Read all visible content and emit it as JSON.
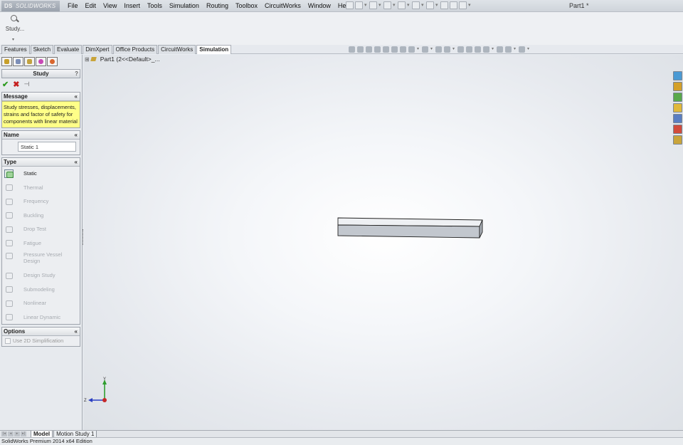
{
  "app": {
    "logo_prefix": "DS",
    "logo_text": "SOLIDWORKS",
    "document_title": "Part1 *"
  },
  "menu": [
    "File",
    "Edit",
    "View",
    "Insert",
    "Tools",
    "Simulation",
    "Routing",
    "Toolbox",
    "CircuitWorks",
    "Window",
    "Help"
  ],
  "command_manager": {
    "study_label": "Study...",
    "expand_marker": "▾"
  },
  "tabs": [
    {
      "label": "Features",
      "active": false
    },
    {
      "label": "Sketch",
      "active": false
    },
    {
      "label": "Evaluate",
      "active": false
    },
    {
      "label": "DimXpert",
      "active": false
    },
    {
      "label": "Office Products",
      "active": false
    },
    {
      "label": "CircuitWorks",
      "active": false
    },
    {
      "label": "Simulation",
      "active": true
    }
  ],
  "property_manager": {
    "title": "Study",
    "help": "?",
    "ok_glyph": "✔",
    "cancel_glyph": "✖",
    "pin_glyph": "⊣",
    "collapse_glyph": "«",
    "message": {
      "header": "Message",
      "text": "Study stresses, displacements, strains and factor of safety for components with linear material"
    },
    "name": {
      "header": "Name",
      "value": "Static 1"
    },
    "type": {
      "header": "Type",
      "items": [
        {
          "label": "Static",
          "enabled": true,
          "selected": true
        },
        {
          "label": "Thermal",
          "enabled": false
        },
        {
          "label": "Frequency",
          "enabled": false
        },
        {
          "label": "Buckling",
          "enabled": false
        },
        {
          "label": "Drop Test",
          "enabled": false
        },
        {
          "label": "Fatigue",
          "enabled": false
        },
        {
          "label": "Pressure Vessel Design",
          "enabled": false,
          "tall": true
        },
        {
          "label": "Design Study",
          "enabled": false
        },
        {
          "label": "Submodeling",
          "enabled": false
        },
        {
          "label": "Nonlinear",
          "enabled": false
        },
        {
          "label": "Linear Dynamic",
          "enabled": false
        }
      ]
    },
    "options": {
      "header": "Options",
      "use_2d_label": "Use 2D Simplification",
      "use_2d_checked": false
    }
  },
  "viewport": {
    "tree_plus": "⊞",
    "tree_item": "Part1  (2<<Default>_...",
    "triad": {
      "y_label": "Y",
      "z_label": "Z",
      "y_color": "#2f9e2f",
      "z_color": "#2a3fc2",
      "x_color": "#c62828"
    },
    "task_icon_colors": [
      "#4a9ad4",
      "#d4a028",
      "#58a84a",
      "#e0b83a",
      "#5a7ec2",
      "#d24b3b",
      "#c9a43a"
    ]
  },
  "bottom_tabs": [
    {
      "label": "Model",
      "active": true
    },
    {
      "label": "Motion Study 1",
      "active": false
    }
  ],
  "status_bar": {
    "text": "SolidWorks Premium 2014 x64 Edition"
  }
}
